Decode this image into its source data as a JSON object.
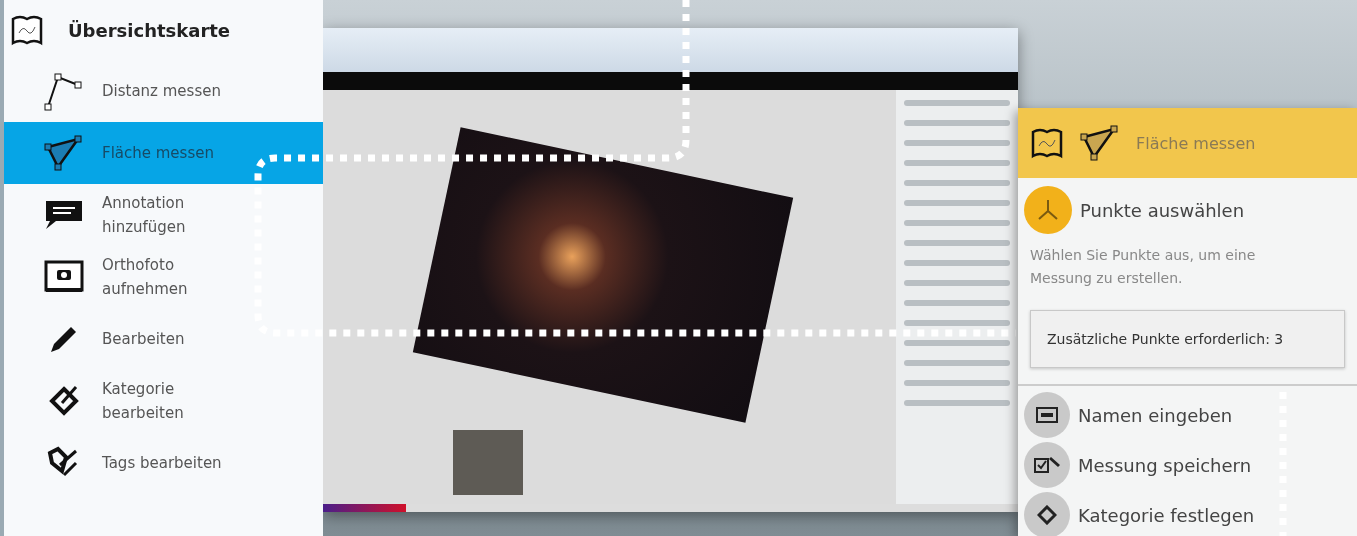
{
  "left_panel": {
    "title": "Übersichtskarte",
    "items": [
      {
        "kind": "distance",
        "label": "Distanz messen",
        "selected": false
      },
      {
        "kind": "area",
        "label": "Fläche messen",
        "selected": true
      },
      {
        "kind": "annotation",
        "label": "Annotation hinzufügen",
        "selected": false
      },
      {
        "kind": "orthophoto",
        "label": "Orthofoto aufnehmen",
        "selected": false
      },
      {
        "kind": "edit",
        "label": "Bearbeiten",
        "selected": false
      },
      {
        "kind": "category",
        "label": "Kategorie bearbeiten",
        "selected": false
      },
      {
        "kind": "tags",
        "label": "Tags bearbeiten",
        "selected": false
      }
    ]
  },
  "right_panel": {
    "header_label": "Fläche messen",
    "step_title": "Punkte auswählen",
    "step_text": "Wählen Sie Punkte aus, um eine Messung zu erstellen.",
    "status": "Zusätzliche Punkte erforderlich: 3",
    "actions": [
      {
        "kind": "name",
        "label": "Namen eingeben"
      },
      {
        "kind": "save",
        "label": "Messung speichern"
      },
      {
        "kind": "category",
        "label": "Kategorie festlegen"
      }
    ]
  }
}
